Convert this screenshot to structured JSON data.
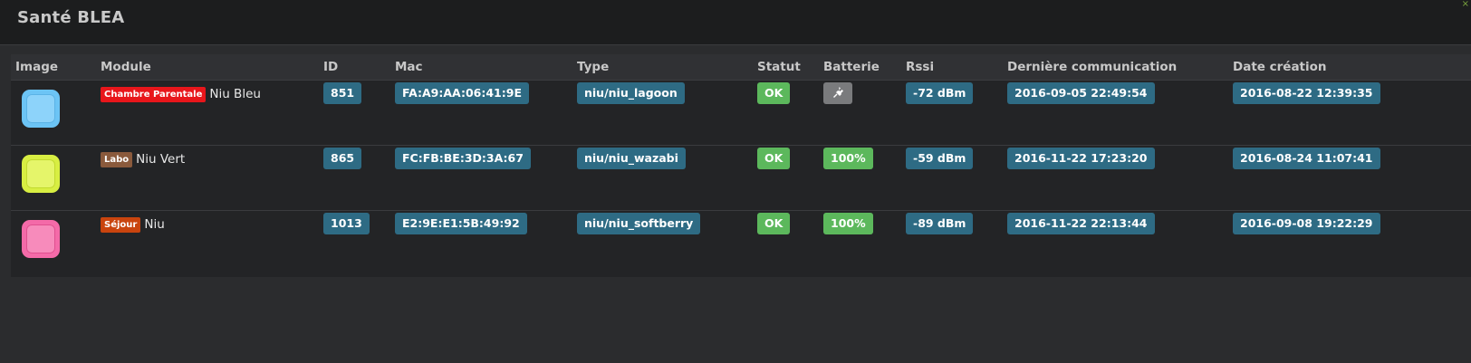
{
  "window": {
    "title": "Santé BLEA",
    "close_label": "×"
  },
  "columns": [
    "Image",
    "Module",
    "ID",
    "Mac",
    "Type",
    "Statut",
    "Batterie",
    "Rssi",
    "Dernière communication",
    "Date création"
  ],
  "rows": [
    {
      "device_color": "#6cc4f5",
      "device_icon": "niu-blue-device",
      "object": {
        "label": "Chambre Parentale",
        "color": "#e8161b"
      },
      "name": "Niu Bleu",
      "id": "851",
      "mac": "FA:A9:AA:06:41:9E",
      "type": "niu/niu_lagoon",
      "status": "OK",
      "battery": {
        "kind": "plug-icon",
        "text": ""
      },
      "rssi": "-72 dBm",
      "last_comm": "2016-09-05 22:49:54",
      "created": "2016-08-22 12:39:35"
    },
    {
      "device_color": "#d8ee42",
      "device_icon": "niu-green-device",
      "object": {
        "label": "Labo",
        "color": "#8a5a3c"
      },
      "name": "Niu Vert",
      "id": "865",
      "mac": "FC:FB:BE:3D:3A:67",
      "type": "niu/niu_wazabi",
      "status": "OK",
      "battery": {
        "kind": "percent",
        "text": "100%"
      },
      "rssi": "-59 dBm",
      "last_comm": "2016-11-22 17:23:20",
      "created": "2016-08-24 11:07:41"
    },
    {
      "device_color": "#f46aa8",
      "device_icon": "niu-pink-device",
      "object": {
        "label": "Séjour",
        "color": "#c9440e"
      },
      "name": "Niu",
      "id": "1013",
      "mac": "E2:9E:E1:5B:49:92",
      "type": "niu/niu_softberry",
      "status": "OK",
      "battery": {
        "kind": "percent",
        "text": "100%"
      },
      "rssi": "-89 dBm",
      "last_comm": "2016-11-22 22:13:44",
      "created": "2016-09-08 19:22:29"
    }
  ],
  "colors": {
    "badge_info": "#2e6b84",
    "badge_success": "#5cb85c",
    "badge_plug": "#7a7b7d"
  }
}
